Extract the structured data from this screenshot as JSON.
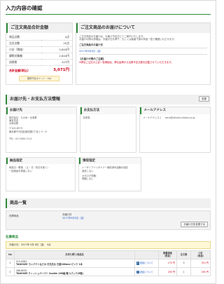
{
  "title": "入力内容の確認",
  "summary": {
    "heading": "ご注文商品合計金額",
    "rows": [
      {
        "label": "商品点数",
        "value": "4点"
      },
      {
        "label": "注文点数",
        "value": "20点"
      },
      {
        "label": "小計（税抜）",
        "value": "2,844円"
      },
      {
        "label": "課税対象額",
        "value": "2,844円"
      },
      {
        "label": "消費税",
        "value": "227円"
      }
    ],
    "total_label": "合計金額(税込)",
    "total_value": "3,071円",
    "points": "獲得予定ポイント：0pt"
  },
  "shipping": {
    "heading": "ご注文商品のお届けについて",
    "line1": "ご注文商品のお届けは、お届け予定日にてご案内いたします。",
    "line2": "お届けの際の詳細は、お届け日を押下、もしくは画面下部の商品一覧で確認いただけます。",
    "date_label": "ご注文商品のお届け日",
    "date": "2017年9月8日（金）",
    "notes_label": "【お届けの際のご注意】",
    "notes": "※弊社ご注文の上記一覧明細は、弊社倉庫から出庫予定日数を記載させていただきます。"
  },
  "delivery": {
    "heading": "お届け先・お支払方法情報",
    "change_label": "変更",
    "address_head": "お届け先",
    "address_lines": [
      "株式会社　たのめーる事業",
      "東京支店",
      "大塚太郎",
      "〒102-8573",
      "東京都千代田区飯田橋2丁目１０−８"
    ],
    "tel": "TEL：03-3264-7111",
    "payment_head": "お支払方法",
    "payment": "請求書",
    "mail_head": "メールアドレス",
    "mail_label": "メールアドレス１",
    "mail": "sano@otsuka-shokai.co.jp",
    "note_head": "納品指定",
    "note_lines": [
      "時品日：曜指　（土・日・祝日を除く）",
      "一括納品を希望しない"
    ],
    "receipt_head": "領収指定",
    "receipt_lines": [
      "レーザープリンタトナー使用済み容器の回収",
      "回収しない",
      "カタログ同梱：",
      "同梱しない"
    ]
  },
  "items": {
    "heading": "商品一覧",
    "stock_label": "在庫商品",
    "date_label": "お届け日",
    "date": "2017年9月8日（金）",
    "delivery_btn": "お届け日を変更する"
  },
  "stock": {
    "heading": "在庫商品",
    "date_bar": "お届け日：2017年 9月 8日（金）　4点",
    "cols": [
      "No",
      "お持ち帰り/商品名",
      "",
      "数量価格\n（税抜）",
      "注文数",
      "小計\n（税抜）"
    ],
    "rows": [
      {
        "no": "1",
        "code": "512-6382",
        "name": "TANOSEE コンパクトはさみ 刃先先丸 刃渡160mm ピンク 1本",
        "price": "170 円",
        "qty": "3",
        "sub": "510 円"
      },
      {
        "no": "2",
        "code": "266-8530",
        "name": "TANOSEE ティッシュペーパー Soahin 200組/箱 1パック(5箱)",
        "price": "295 円",
        "qty": "1",
        "sub": "295 円"
      }
    ],
    "link_label": "返品について"
  }
}
